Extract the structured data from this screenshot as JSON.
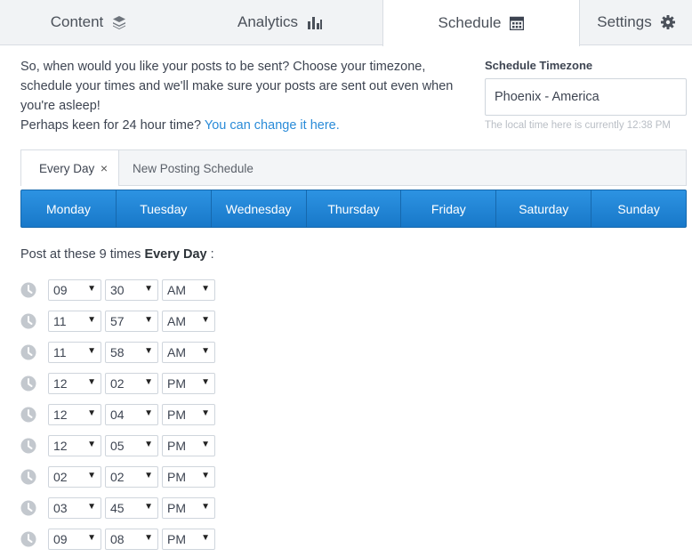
{
  "tabs": [
    {
      "label": "Content",
      "icon": "layers-icon"
    },
    {
      "label": "Analytics",
      "icon": "bar-chart-icon"
    },
    {
      "label": "Schedule",
      "icon": "calendar-icon",
      "active": true
    },
    {
      "label": "Settings",
      "icon": "gear-icon"
    }
  ],
  "intro": {
    "text": "So, when would you like your posts to be sent? Choose your timezone, schedule your times and we'll make sure your posts are sent out even when you're asleep!",
    "prompt": "Perhaps keen for 24 hour time?",
    "link": "You can change it here."
  },
  "timezone": {
    "label": "Schedule Timezone",
    "value": "Phoenix - America",
    "note": "The local time here is currently 12:38 PM"
  },
  "schedule_tabs": {
    "active": "Every Day",
    "close": "×",
    "new": "New Posting Schedule"
  },
  "days": [
    "Monday",
    "Tuesday",
    "Wednesday",
    "Thursday",
    "Friday",
    "Saturday",
    "Sunday"
  ],
  "post_line": {
    "prefix": "Post at these 9 times",
    "bold": "Every Day",
    "suffix": ":"
  },
  "times": [
    {
      "hour": "09",
      "minute": "30",
      "ampm": "AM"
    },
    {
      "hour": "11",
      "minute": "57",
      "ampm": "AM"
    },
    {
      "hour": "11",
      "minute": "58",
      "ampm": "AM"
    },
    {
      "hour": "12",
      "minute": "02",
      "ampm": "PM"
    },
    {
      "hour": "12",
      "minute": "04",
      "ampm": "PM"
    },
    {
      "hour": "12",
      "minute": "05",
      "ampm": "PM"
    },
    {
      "hour": "02",
      "minute": "02",
      "ampm": "PM"
    },
    {
      "hour": "03",
      "minute": "45",
      "ampm": "PM"
    },
    {
      "hour": "09",
      "minute": "08",
      "ampm": "PM"
    }
  ],
  "colors": {
    "accent": "#2a8bd8",
    "day_bar": "#1f84d4",
    "clock": "#c3c8ce"
  }
}
